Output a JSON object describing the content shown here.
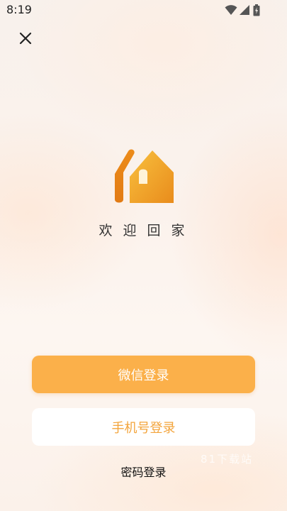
{
  "status_bar": {
    "time": "8:19",
    "icons": [
      "wifi-icon",
      "signal-icon",
      "battery-icon"
    ]
  },
  "header": {
    "close_icon": "close-icon"
  },
  "brand": {
    "logo_icon": "house-logo-icon",
    "welcome_text": "欢迎回家",
    "colors": {
      "logo_dark": "#e8861a",
      "logo_light": "#f6b73a"
    }
  },
  "login": {
    "wechat_label": "微信登录",
    "phone_label": "手机号登录",
    "password_label": "密码登录",
    "colors": {
      "wechat_bg": "#fbb04a",
      "phone_text": "#f3a43b"
    }
  },
  "watermark": "81下载站"
}
